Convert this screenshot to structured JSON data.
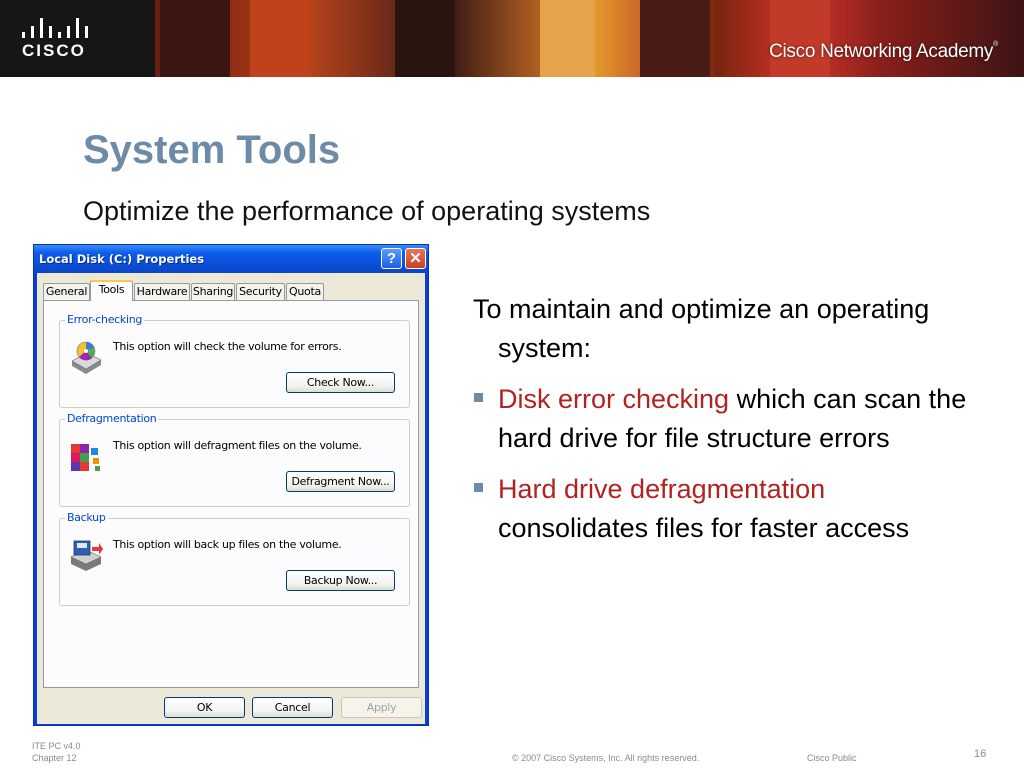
{
  "banner": {
    "logo_text": "CISCO",
    "academy_text": "Cisco Networking Academy"
  },
  "slide": {
    "title": "System Tools",
    "subtitle": "Optimize the performance of operating systems",
    "intro": "To maintain and optimize an operating system:",
    "bullets": [
      {
        "highlight": "Disk error checking",
        "rest": " which can scan the hard drive for file structure errors"
      },
      {
        "highlight": "Hard drive defragmentation",
        "rest": " consolidates files for faster access"
      }
    ],
    "highlight_color": "#b22222",
    "title_color": "#6d8aa6"
  },
  "dialog": {
    "title": "Local Disk (C:) Properties",
    "help_label": "?",
    "close_label": "✕",
    "tabs": [
      "General",
      "Tools",
      "Hardware",
      "Sharing",
      "Security",
      "Quota"
    ],
    "active_tab": "Tools",
    "groups": [
      {
        "legend": "Error-checking",
        "description": "This option will check the volume for errors.",
        "button": "Check Now...",
        "icon": "disk-check-icon"
      },
      {
        "legend": "Defragmentation",
        "description": "This option will defragment files on the volume.",
        "button": "Defragment Now...",
        "icon": "defragment-icon"
      },
      {
        "legend": "Backup",
        "description": "This option will back up files on the volume.",
        "button": "Backup Now...",
        "icon": "backup-icon"
      }
    ],
    "buttons": {
      "ok": "OK",
      "cancel": "Cancel",
      "apply": "Apply"
    }
  },
  "footer": {
    "course": "ITE PC v4.0",
    "chapter": "Chapter 12",
    "copyright": "© 2007 Cisco Systems, Inc. All rights reserved.",
    "classification": "Cisco Public",
    "page_number": "16"
  }
}
